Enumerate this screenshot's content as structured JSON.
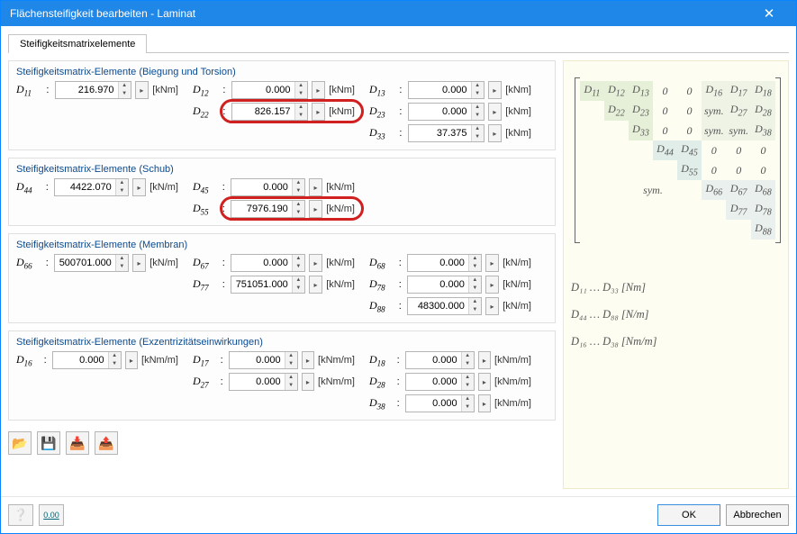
{
  "window": {
    "title": "Flächensteifigkeit bearbeiten - Laminat"
  },
  "tab": {
    "label": "Steifigkeitsmatrixelemente"
  },
  "groups": {
    "bending": {
      "title": "Steifigkeitsmatrix-Elemente (Biegung und Torsion)"
    },
    "shear": {
      "title": "Steifigkeitsmatrix-Elemente (Schub)"
    },
    "membrane": {
      "title": "Steifigkeitsmatrix-Elemente (Membran)"
    },
    "ecc": {
      "title": "Steifigkeitsmatrix-Elemente (Exzentrizitätseinwirkungen)"
    }
  },
  "units": {
    "kNm": "[kNm]",
    "kNpm": "[kN/m]",
    "kNmpm": "[kNm/m]"
  },
  "fields": {
    "D11": "216.970",
    "D12": "0.000",
    "D13": "0.000",
    "D22": "826.157",
    "D23": "0.000",
    "D33": "37.375",
    "D44": "4422.070",
    "D45": "0.000",
    "D55": "7976.190",
    "D66": "500701.000",
    "D67": "0.000",
    "D68": "0.000",
    "D77": "751051.000",
    "D78": "0.000",
    "D88": "48300.000",
    "D16": "0.000",
    "D17": "0.000",
    "D18": "0.000",
    "D27": "0.000",
    "D28": "0.000",
    "D38": "0.000"
  },
  "sym": "sym.",
  "legend": {
    "l1": "D₁₁ … D₃₃  [Nm]",
    "l2": "D₄₄ … D₈₈  [N/m]",
    "l3": "D₁₆ … D₃₈  [Nm/m]"
  },
  "buttons": {
    "ok": "OK",
    "cancel": "Abbrechen"
  }
}
